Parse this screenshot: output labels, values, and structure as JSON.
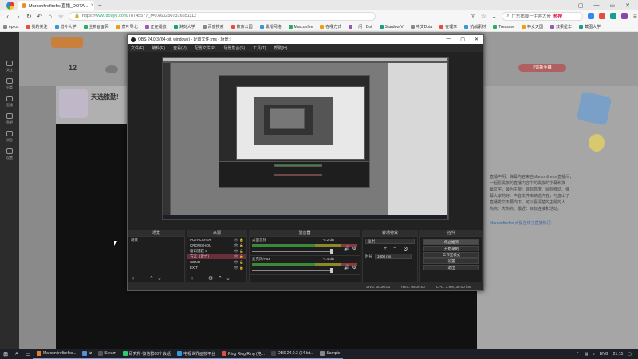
{
  "browser": {
    "tab_title": "Marconfirefirefox直播_DOTA...",
    "new_tab": "+",
    "window_controls": [
      "▢",
      "—",
      "▭",
      "✕"
    ],
    "url_prefix": "https://",
    "url_domain": "www.douyu.com",
    "url_rest": "/78745577_r=0.6602507316651112",
    "search_text": "广东猪脚一生两大骨",
    "search_hot": "热搜",
    "bookmarks": [
      "eprox",
      "我的关注",
      "增补大学",
      "全新画面网",
      "蕉叶导北",
      "正在播放",
      "淋刻大学",
      "百度搜索",
      "搜索公园",
      "黑帽网络",
      "Marconfire",
      "在哪方式",
      "一问 · Dot",
      "Stardew V",
      "中文Dota",
      "在理享",
      "抗战素材",
      "Treasure",
      "神女天国",
      "效果星华",
      "截图大学"
    ]
  },
  "douyu": {
    "sidebar": [
      "关注",
      "分类",
      "直播",
      "鱼吧",
      "消息",
      "设置"
    ],
    "header_count": "12",
    "banner_title": "天选旅勤!",
    "right_banner": "P站新手推",
    "chat_lines": [
      "直播声明：弹幕内容来自Marconfirefox直播间，",
      "一起看黑夜的直播内容中的黑夜的字幕和弹",
      "幕文字，最为主要：目标高度、鼠标移动、弹",
      "幕大家的好：声音文件由精选内容，与盘山了",
      "直播发文不要向下，可以看清楚的主题的人",
      "热点：大热点、最近：目标连接和活动。",
      "Marconfirefox 大鼠在线了直播热门"
    ]
  },
  "obs": {
    "title": "OBS 24.0.3 (64-bit, windows) - 配置文件: ms - 场景: ▢",
    "window_controls": [
      "—",
      "▢",
      "✕"
    ],
    "menu": [
      "文件(F)",
      "编辑(E)",
      "查看(V)",
      "配置文件(P)",
      "场景集合(S)",
      "工具(T)",
      "帮助(H)"
    ],
    "docks": {
      "scenes": "场景",
      "sources": "来源",
      "mixer": "混音器",
      "transitions": "转场特效",
      "controls": "控件"
    },
    "scene_items": [
      "场景"
    ],
    "source_items": [
      "POTPLAYER",
      "CROWSHOU",
      "窗口捕获 3",
      "方言（近亡）",
      "CDNO",
      "EXIT"
    ],
    "mixer_channels": [
      {
        "name": "桌面音频",
        "db": "-5.2 dB"
      },
      {
        "name": "麦克风/Aux",
        "db": "-4.4 dB"
      }
    ],
    "transition": {
      "type": "淡出",
      "duration_label": "时长",
      "duration": "1000 ms"
    },
    "control_buttons": [
      "停止推流",
      "开始录制",
      "工作室模式",
      "设置",
      "退出"
    ],
    "status": {
      "live": "LIVE: 00:00:00",
      "rec": "REC: 00:00:00",
      "cpu": "CPU: 3.9%, 30.00 fps"
    }
  },
  "taskbar": {
    "apps": [
      {
        "label": "Marconfirefirefox...",
        "color": "#e67e22"
      },
      {
        "label": "tz",
        "color": "#5a8fd8"
      },
      {
        "label": "Steam",
        "color": "#555"
      },
      {
        "label": "研究所·微信群60个会话",
        "color": "#2ecc71"
      },
      {
        "label": "电视世界画技平台",
        "color": "#3498db"
      },
      {
        "label": "Ring Ring Ring (电...",
        "color": "#e74c3c"
      },
      {
        "label": "OBS 24.0.3 (64-bit...",
        "color": "#444"
      },
      {
        "label": "Sample",
        "color": "#888"
      }
    ],
    "tray_lang": "ENG",
    "clock": "21:15"
  }
}
